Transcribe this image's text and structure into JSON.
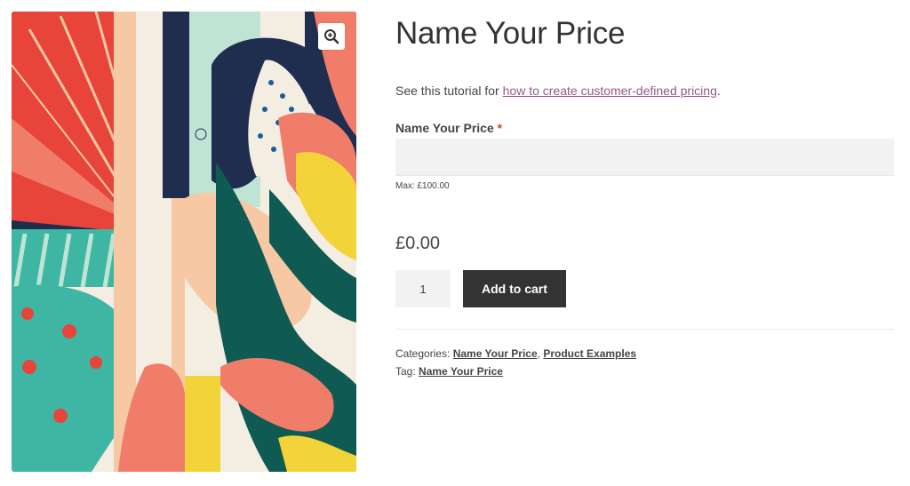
{
  "product": {
    "title": "Name Your Price",
    "description_prefix": "See this tutorial for ",
    "description_link": "how to create customer-defined pricing",
    "description_suffix": ".",
    "price_field_label": "Name Your Price",
    "required_mark": "*",
    "price_field_value": "",
    "max_note": "Max: £100.00",
    "price": "£0.00",
    "quantity": "1",
    "add_to_cart_label": "Add to cart"
  },
  "meta": {
    "categories_label": "Categories:",
    "categories": [
      "Name Your Price",
      "Product Examples"
    ],
    "category_separator": ",",
    "tag_label": "Tag:",
    "tag": "Name Your Price"
  },
  "gallery": {
    "zoom_icon": "magnifier-plus-icon",
    "colors": {
      "red": "#e8443a",
      "coral": "#f07d6a",
      "peach": "#f6c9a4",
      "cream": "#f4ede2",
      "navy": "#1f2e4f",
      "teal": "#0f5a52",
      "turquoise": "#3fb6a3",
      "mint": "#bfe3d4",
      "yellow": "#f2d33a",
      "pink": "#f4a3a0"
    }
  }
}
